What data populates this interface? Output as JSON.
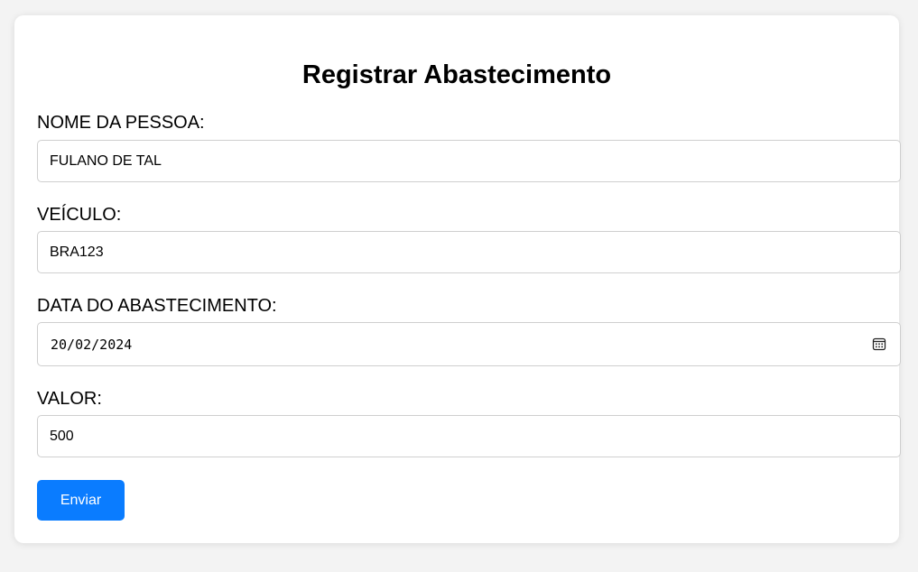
{
  "form": {
    "title": "Registrar Abastecimento",
    "fields": {
      "nome": {
        "label": "NOME DA PESSOA:",
        "value": "FULANO DE TAL"
      },
      "veiculo": {
        "label": "VEÍCULO:",
        "value": "BRA123"
      },
      "data": {
        "label": "DATA DO ABASTECIMENTO:",
        "value": "20/02/2024",
        "icon": "calendar-icon"
      },
      "valor": {
        "label": "VALOR:",
        "value": "500"
      }
    },
    "submit_label": "Enviar"
  },
  "colors": {
    "accent": "#0a7cff",
    "background": "#f3f3f3",
    "card": "#ffffff",
    "border": "#cfcfcf"
  }
}
